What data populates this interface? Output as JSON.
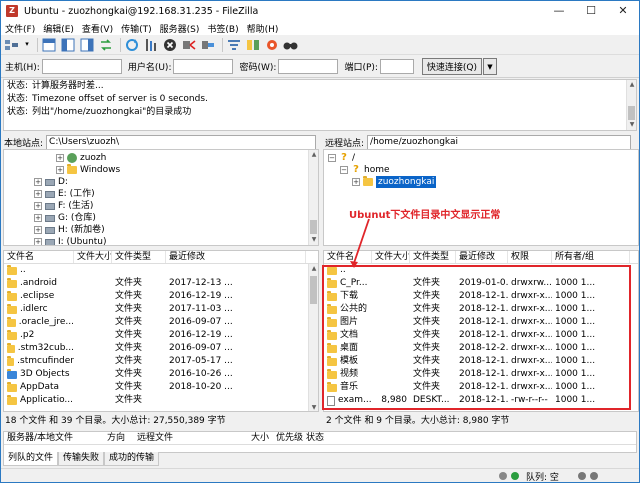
{
  "window": {
    "title": "Ubuntu - zuozhongkai@192.168.31.235 - FileZilla",
    "app_icon": "filezilla-icon",
    "controls": [
      "—",
      "☐",
      "✕"
    ]
  },
  "menu": [
    "文件(F)",
    "编辑(E)",
    "查看(V)",
    "传输(T)",
    "服务器(S)",
    "书签(B)",
    "帮助(H)"
  ],
  "quickconnect": {
    "host_label": "主机(H):",
    "user_label": "用户名(U):",
    "pass_label": "密码(W):",
    "port_label": "端口(P):",
    "host_value": "",
    "user_value": "",
    "pass_value": "",
    "port_value": "",
    "button": "快速连接(Q)",
    "dropdown": "▼"
  },
  "log": [
    {
      "label": "状态:",
      "text": "计算服务器时差..."
    },
    {
      "label": "状态:",
      "text": "Timezone offset of server is 0 seconds."
    },
    {
      "label": "状态:",
      "text": "列出\"/home/zuozhongkai\"的目录成功"
    }
  ],
  "local": {
    "site_label": "本地站点:",
    "path": "C:\\Users\\zuozh\\",
    "tree": [
      {
        "label": "zuozh",
        "icon": "user"
      },
      {
        "label": "Windows",
        "icon": "folder"
      },
      {
        "label": "D:",
        "icon": "drive"
      },
      {
        "label": "E: (工作)",
        "icon": "drive"
      },
      {
        "label": "F: (生活)",
        "icon": "drive"
      },
      {
        "label": "G: (仓库)",
        "icon": "drive"
      },
      {
        "label": "H: (新加卷)",
        "icon": "drive"
      },
      {
        "label": "I: (Ubuntu)",
        "icon": "drive"
      }
    ],
    "columns": [
      "文件名",
      "文件大小",
      "文件类型",
      "最近修改"
    ],
    "files": [
      {
        "name": "..",
        "size": "",
        "type": "",
        "modified": ""
      },
      {
        "name": ".android",
        "size": "",
        "type": "文件夹",
        "modified": "2017-12-13 ..."
      },
      {
        "name": ".eclipse",
        "size": "",
        "type": "文件夹",
        "modified": "2016-12-19 ..."
      },
      {
        "name": ".idlerc",
        "size": "",
        "type": "文件夹",
        "modified": "2017-11-03 ..."
      },
      {
        "name": ".oracle_jre...",
        "size": "",
        "type": "文件夹",
        "modified": "2016-09-07 ..."
      },
      {
        "name": ".p2",
        "size": "",
        "type": "文件夹",
        "modified": "2016-12-19 ..."
      },
      {
        "name": ".stm32cub...",
        "size": "",
        "type": "文件夹",
        "modified": "2016-09-07 ..."
      },
      {
        "name": ".stmcufinder",
        "size": "",
        "type": "文件夹",
        "modified": "2017-05-17 ..."
      },
      {
        "name": "3D Objects",
        "size": "",
        "type": "文件夹",
        "modified": "2016-10-26 ..."
      },
      {
        "name": "AppData",
        "size": "",
        "type": "文件夹",
        "modified": "2018-10-20 ..."
      },
      {
        "name": "Applicatio...",
        "size": "",
        "type": "文件夹",
        "modified": ""
      }
    ],
    "status": "18 个文件 和 39 个目录。大小总计: 27,550,389 字节"
  },
  "remote": {
    "site_label": "远程站点:",
    "path": "/home/zuozhongkai",
    "tree": [
      {
        "label": "/",
        "icon": "unknown"
      },
      {
        "label": "home",
        "icon": "unknown"
      },
      {
        "label": "zuozhongkai",
        "icon": "folder"
      }
    ],
    "columns": [
      "文件名",
      "文件大小",
      "文件类型",
      "最近修改",
      "权限",
      "所有者/组"
    ],
    "files": [
      {
        "name": "..",
        "size": "",
        "type": "",
        "modified": "",
        "perm": "",
        "owner": ""
      },
      {
        "name": "C_Pr...",
        "size": "",
        "type": "文件夹",
        "modified": "2019-01-0...",
        "perm": "drwxrw...",
        "owner": "1000 1..."
      },
      {
        "name": "下载",
        "size": "",
        "type": "文件夹",
        "modified": "2018-12-1...",
        "perm": "drwxr-x...",
        "owner": "1000 1..."
      },
      {
        "name": "公共的",
        "size": "",
        "type": "文件夹",
        "modified": "2018-12-1...",
        "perm": "drwxr-x...",
        "owner": "1000 1..."
      },
      {
        "name": "图片",
        "size": "",
        "type": "文件夹",
        "modified": "2018-12-1...",
        "perm": "drwxr-x...",
        "owner": "1000 1..."
      },
      {
        "name": "文档",
        "size": "",
        "type": "文件夹",
        "modified": "2018-12-1...",
        "perm": "drwxr-x...",
        "owner": "1000 1..."
      },
      {
        "name": "桌面",
        "size": "",
        "type": "文件夹",
        "modified": "2018-12-2...",
        "perm": "drwxr-x...",
        "owner": "1000 1..."
      },
      {
        "name": "模板",
        "size": "",
        "type": "文件夹",
        "modified": "2018-12-1...",
        "perm": "drwxr-x...",
        "owner": "1000 1..."
      },
      {
        "name": "视频",
        "size": "",
        "type": "文件夹",
        "modified": "2018-12-1...",
        "perm": "drwxr-x...",
        "owner": "1000 1..."
      },
      {
        "name": "音乐",
        "size": "",
        "type": "文件夹",
        "modified": "2018-12-1...",
        "perm": "drwxr-x...",
        "owner": "1000 1..."
      },
      {
        "name": "exam...",
        "size": "8,980",
        "type": "DESKT...",
        "modified": "2018-12-1...",
        "perm": "-rw-r--r--",
        "owner": "1000 1..."
      }
    ],
    "status": "2 个文件 和 9 个目录。大小总计: 8,980 字节"
  },
  "annotation": "Ubunut下文件目录中文显示正常",
  "annotation_color": "#e0252a",
  "queue": {
    "columns": [
      "服务器/本地文件",
      "方向",
      "远程文件",
      "大小",
      "优先级",
      "状态"
    ],
    "tabs": [
      "列队的文件",
      "传输失败",
      "成功的传输"
    ]
  },
  "statusbar": {
    "queue": "队列: 空"
  }
}
